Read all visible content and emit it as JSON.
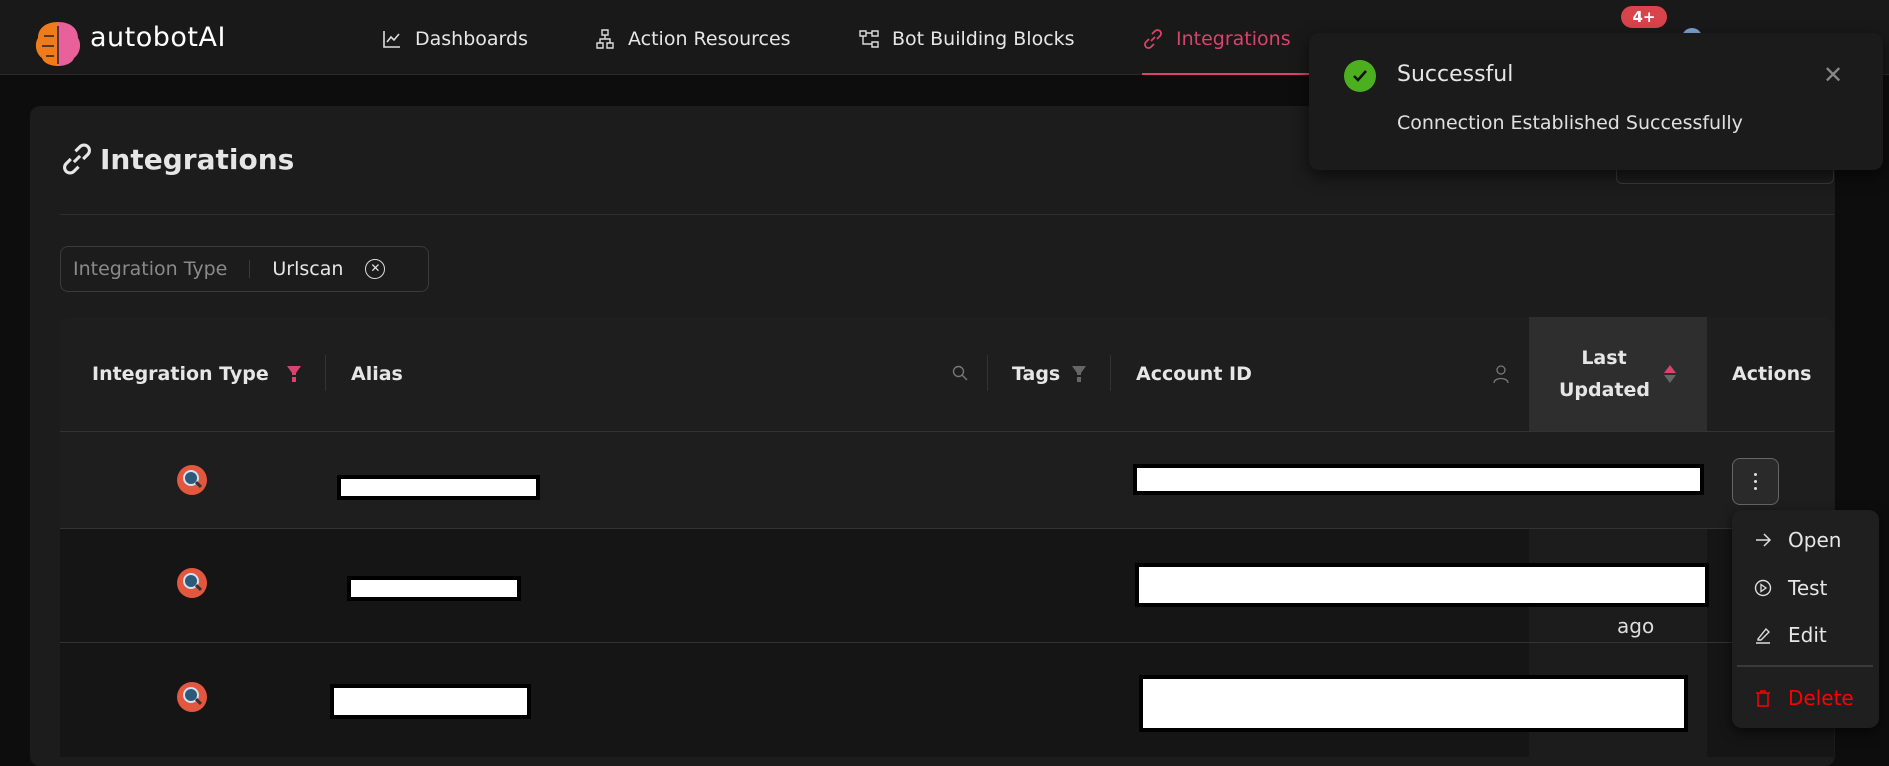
{
  "app": {
    "logo_text": "autobotAI",
    "brand_color": "#d9436d"
  },
  "nav": {
    "items": [
      {
        "label": "Dashboards",
        "icon": "chart-line-icon"
      },
      {
        "label": "Action Resources",
        "icon": "sitemap-icon"
      },
      {
        "label": "Bot Building Blocks",
        "icon": "blocks-icon"
      },
      {
        "label": "Integrations",
        "icon": "link-icon",
        "active": true
      }
    ],
    "notification_badge": "4+"
  },
  "page": {
    "title": "Integrations"
  },
  "filter": {
    "label": "Integration Type",
    "value": "Urlscan"
  },
  "table": {
    "columns": [
      "Integration Type",
      "Alias",
      "Tags",
      "Account ID",
      "Last Updated",
      "Actions"
    ],
    "rows": [
      {
        "type_icon": "urlscan-icon",
        "alias": "[redacted]",
        "account_id": "[redacted]",
        "last_updated": ""
      },
      {
        "type_icon": "urlscan-icon",
        "alias": "[redacted]",
        "account_id": "[redacted]",
        "last_updated": "ago"
      },
      {
        "type_icon": "urlscan-icon",
        "alias": "[redacted]",
        "account_id": "[redacted]",
        "last_updated": ""
      }
    ]
  },
  "row_menu": {
    "items": [
      {
        "label": "Open",
        "icon": "arrow-right-icon"
      },
      {
        "label": "Test",
        "icon": "play-circle-icon"
      },
      {
        "label": "Edit",
        "icon": "pencil-icon"
      },
      {
        "label": "Delete",
        "icon": "trash-icon",
        "color": "#ff0000"
      }
    ]
  },
  "toast": {
    "title": "Successful",
    "message": "Connection Established Successfully",
    "status_color": "#4caf1f"
  }
}
